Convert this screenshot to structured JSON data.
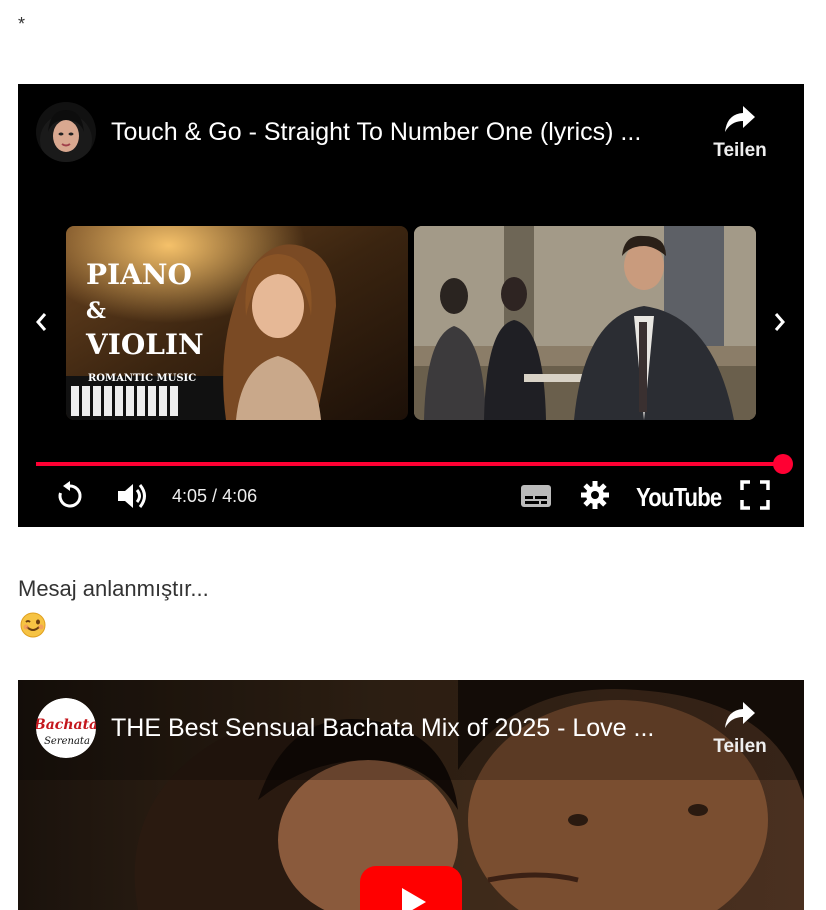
{
  "page": {
    "asterisk": "*",
    "message": "Mesaj anlanmıştır..."
  },
  "player1": {
    "title": "Touch & Go - Straight To Number One (lyrics) ...",
    "share_label": "Teilen",
    "time_current": "4:05",
    "time_separator": " / ",
    "time_total": "4:06",
    "progress_fraction": 0.996,
    "logo_text": "YouTube",
    "endscreen": [
      {
        "title_line1": "PIANO",
        "title_line2": "&",
        "title_line3": "VIOLIN",
        "subtitle": "ROMANTIC MUSIC"
      },
      {
        "title_line1": ""
      }
    ]
  },
  "player2": {
    "title": "THE Best Sensual Bachata Mix of 2025 - Love ...",
    "share_label": "Teilen",
    "channel_logo_line1": "Bachata",
    "channel_logo_line2": "Serenata"
  },
  "colors": {
    "accent": "#ff0033",
    "player_bg": "#000000"
  }
}
